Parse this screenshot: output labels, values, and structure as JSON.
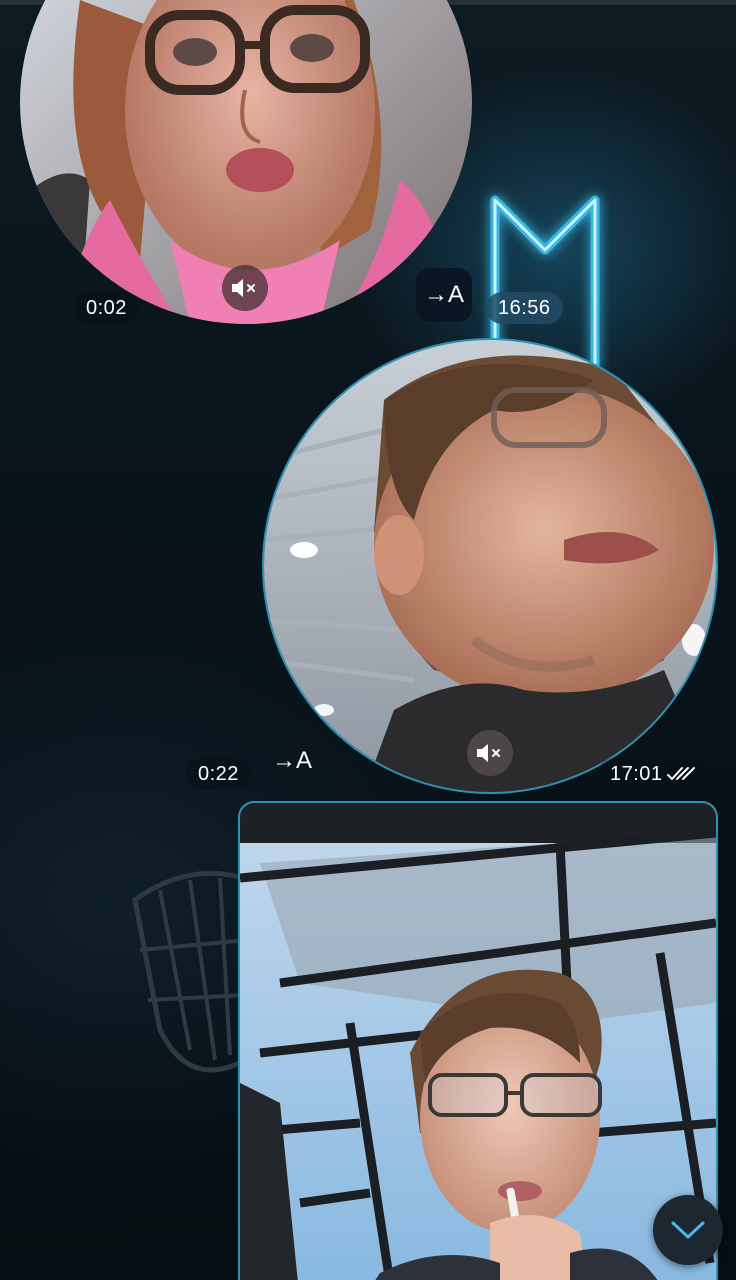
{
  "messages": [
    {
      "type": "round-video",
      "duration": "0:02",
      "muted": true,
      "translate_label": "→A",
      "time": "16:56"
    },
    {
      "type": "round-video",
      "duration": "0:22",
      "muted": true,
      "translate_label": "→A",
      "time": "17:01",
      "status_icon": "double-check-icon"
    },
    {
      "type": "video"
    }
  ],
  "icons": {
    "mute": "speaker-muted-icon",
    "translate": "translate-icon",
    "read_status": "double-check-icon",
    "scroll_down": "chevron-down-icon"
  },
  "colors": {
    "accent": "#2a93b5",
    "timestamp_pill": "#234b64",
    "background": "#08131a",
    "neon": "#3fc4f0"
  }
}
